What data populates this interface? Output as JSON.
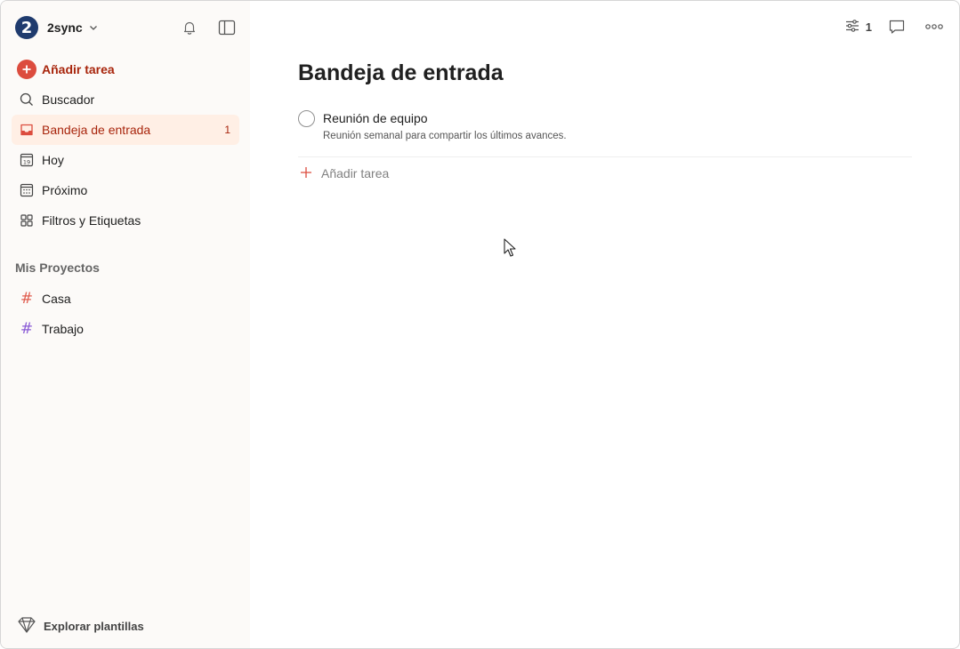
{
  "user": {
    "name": "2sync",
    "avatar_text": "2"
  },
  "sidebar": {
    "add_task_label": "Añadir tarea",
    "nav": [
      {
        "label": "Buscador",
        "icon": "search-icon"
      },
      {
        "label": "Bandeja de entrada",
        "icon": "inbox-icon",
        "count": "1",
        "active": true
      },
      {
        "label": "Hoy",
        "icon": "calendar-today-icon",
        "day": "19"
      },
      {
        "label": "Próximo",
        "icon": "calendar-grid-icon"
      },
      {
        "label": "Filtros y Etiquetas",
        "icon": "filters-icon"
      }
    ],
    "projects_title": "Mis Proyectos",
    "projects": [
      {
        "label": "Casa",
        "color": "#e05d4f"
      },
      {
        "label": "Trabajo",
        "color": "#8a5bd6"
      }
    ],
    "footer_label": "Explorar plantillas"
  },
  "main": {
    "title": "Bandeja de entrada",
    "view_count": "1",
    "tasks": [
      {
        "title": "Reunión de equipo",
        "description": "Reunión semanal para compartir los últimos avances."
      }
    ],
    "add_task_label": "Añadir tarea"
  },
  "colors": {
    "accent": "#dc4c3e",
    "active_bg": "#ffefe5",
    "sidebar_bg": "#fcfaf8"
  }
}
